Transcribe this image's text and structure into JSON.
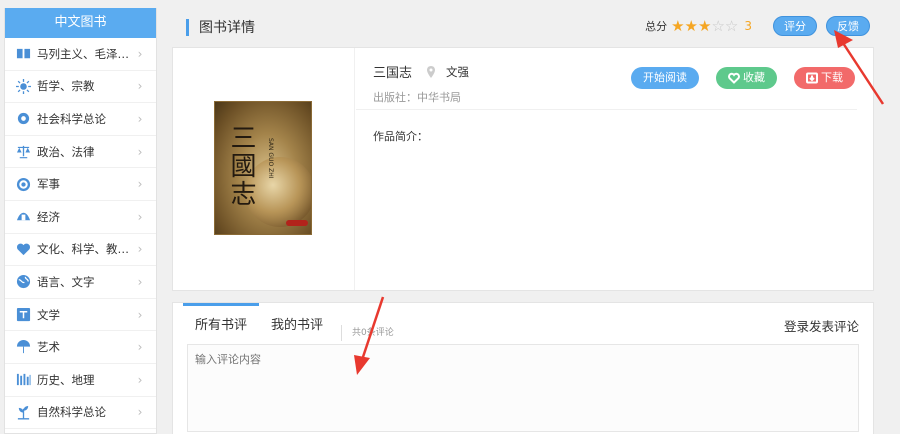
{
  "sidebar": {
    "title": "中文图书",
    "items": [
      {
        "label": "马列主义、毛泽…",
        "icon": "book-icon"
      },
      {
        "label": "哲学、宗教",
        "icon": "sun-icon"
      },
      {
        "label": "社会科学总论",
        "icon": "circle-icon"
      },
      {
        "label": "政治、法律",
        "icon": "scale-icon"
      },
      {
        "label": "军事",
        "icon": "target-icon"
      },
      {
        "label": "经济",
        "icon": "hands-icon"
      },
      {
        "label": "文化、科学、教…",
        "icon": "heart-icon"
      },
      {
        "label": "语言、文字",
        "icon": "globe-icon"
      },
      {
        "label": "文学",
        "icon": "text-icon"
      },
      {
        "label": "艺术",
        "icon": "fan-icon"
      },
      {
        "label": "历史、地理",
        "icon": "bars-icon"
      },
      {
        "label": "自然科学总论",
        "icon": "plant-icon"
      }
    ]
  },
  "header": {
    "title": "图书详情",
    "score_label": "总分",
    "score_value": "3",
    "stars_filled": 3,
    "stars_total": 5,
    "rate_button": "评分",
    "feedback_button": "反馈"
  },
  "book": {
    "name": "三国志",
    "author": "文强",
    "publisher_label": "出版社：",
    "publisher": "中华书局",
    "intro_label": "作品简介：",
    "cover_title": "三國志",
    "cover_subtitle": "SAN GUO ZHI",
    "read_button": "开始阅读",
    "favorite_button": "收藏",
    "download_button": "下载"
  },
  "reviews": {
    "tab_all": "所有书评",
    "tab_mine": "我的书评",
    "count_text": "共0条评论",
    "login_link": "登录发表评论",
    "input_placeholder": "输入评论内容"
  },
  "colors": {
    "accent": "#5aabf0",
    "favorite": "#5ec98c",
    "download": "#f26a6a",
    "star": "#f5a623",
    "annotation_arrow": "#e8392f"
  }
}
